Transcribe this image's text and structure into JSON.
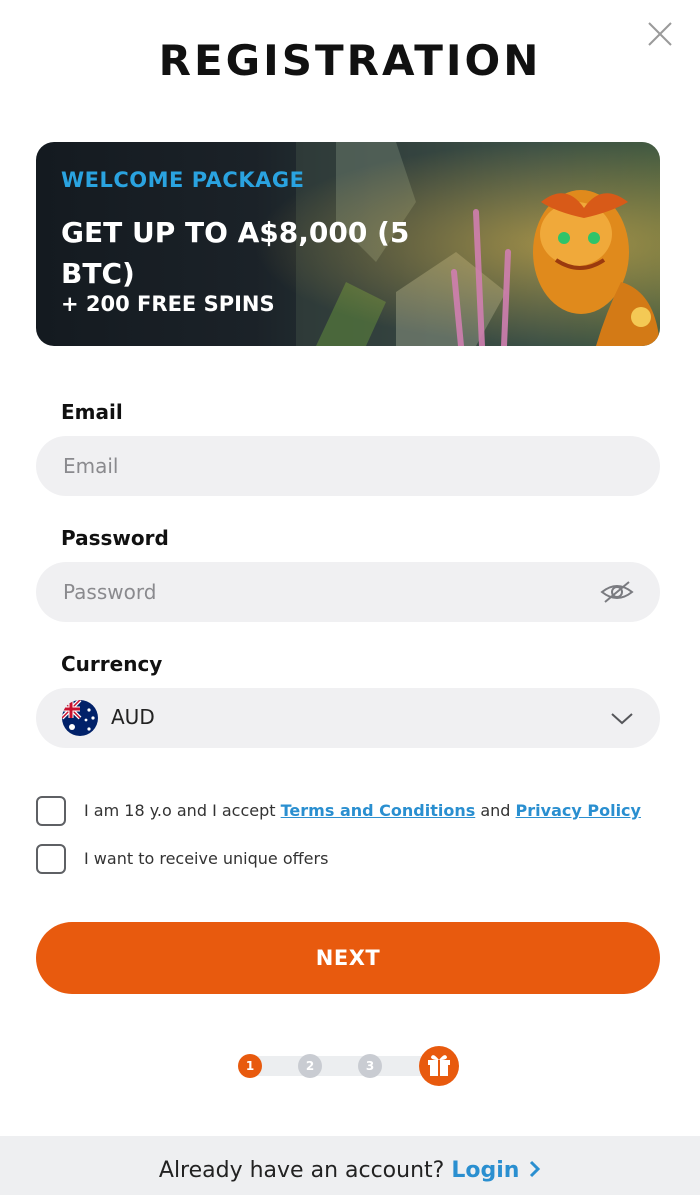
{
  "modal": {
    "title": "REGISTRATION"
  },
  "banner": {
    "eyebrow": "WELCOME PACKAGE",
    "headline": "GET UP TO A$8,000 (5 BTC)",
    "subline": "+ 200 FREE SPINS"
  },
  "form": {
    "email": {
      "label": "Email",
      "placeholder": "Email",
      "value": ""
    },
    "password": {
      "label": "Password",
      "placeholder": "Password",
      "value": ""
    },
    "currency": {
      "label": "Currency",
      "selected": "AUD",
      "flag_icon": "australia-flag-icon"
    }
  },
  "consent": {
    "age_prefix": "I am 18 y.o and I accept",
    "terms_link": "Terms and Conditions",
    "and_text": "and",
    "privacy_link": "Privacy Policy",
    "offers_text": "I want to receive unique offers"
  },
  "actions": {
    "next_label": "NEXT"
  },
  "steps": {
    "items": [
      "1",
      "2",
      "3"
    ],
    "current": 1,
    "final_icon": "gift-icon"
  },
  "footer": {
    "prompt": "Already have an account?",
    "login_label": "Login"
  },
  "colors": {
    "accent": "#e85a0e",
    "link": "#2a8fd0",
    "eyebrow": "#2aa3e0",
    "field_bg": "#f0f0f2"
  }
}
